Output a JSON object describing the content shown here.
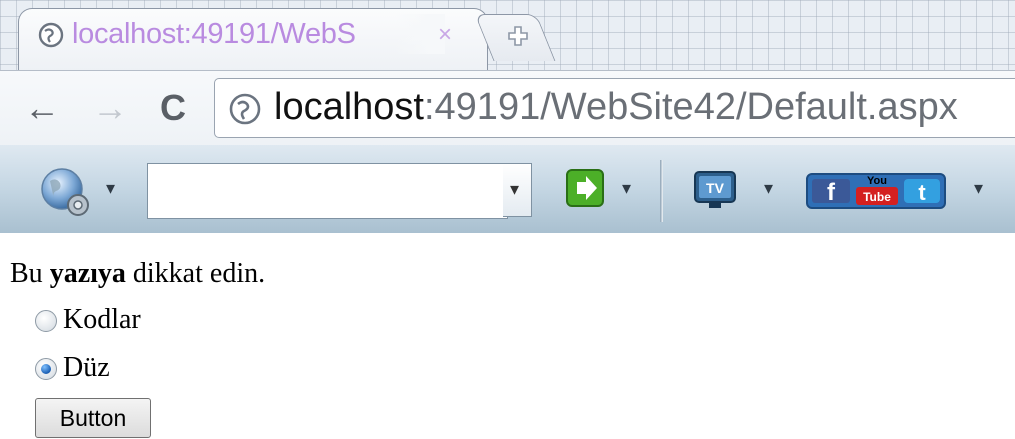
{
  "browser": {
    "tab": {
      "title": "localhost:49191/WebS",
      "close_glyph": "×"
    },
    "address": {
      "host": "localhost",
      "rest": ":49191/WebSite42/Default.aspx"
    },
    "nav": {
      "back_glyph": "←",
      "forward_glyph": "→",
      "reload_glyph": "C"
    },
    "icons": [
      "globe-icon",
      "new-tab-icon",
      "page-icon",
      "back-arrow-icon",
      "forward-arrow-icon",
      "reload-icon"
    ]
  },
  "toolbar": {
    "search_value": "",
    "dropdown_glyph": "▾",
    "icons": [
      "globe-settings-icon",
      "green-go-icon",
      "tv-icon",
      "facebook-youtube-twitter-icon"
    ],
    "social_youtube_text": "You",
    "social_youtube_tube": "Tube"
  },
  "page": {
    "line_prefix": "Bu ",
    "line_bold": "yazıya",
    "line_suffix": " dikkat edin.",
    "radios": [
      {
        "label": "Kodlar",
        "checked": false
      },
      {
        "label": "Düz",
        "checked": true
      }
    ],
    "button_label": "Button"
  }
}
